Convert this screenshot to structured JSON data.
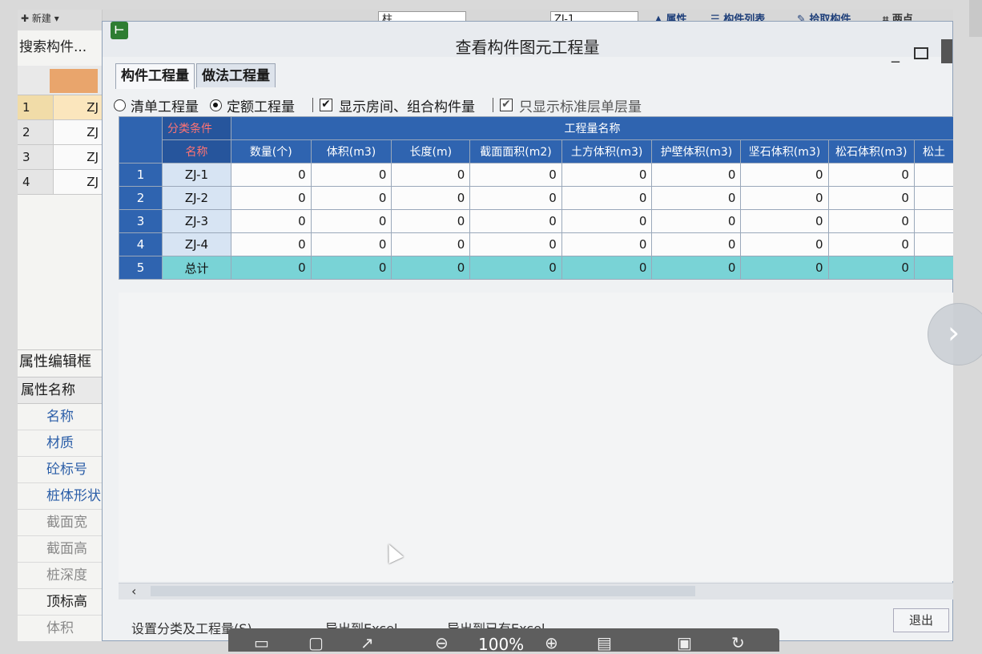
{
  "left_panel": {
    "toolbar_text": "新建",
    "search_text": "搜索构件...",
    "list": [
      {
        "idx": "1",
        "name": "ZJ"
      },
      {
        "idx": "2",
        "name": "ZJ"
      },
      {
        "idx": "3",
        "name": "ZJ"
      },
      {
        "idx": "4",
        "name": "ZJ"
      }
    ],
    "prop_title": "属性编辑框",
    "prop_header": "属性名称",
    "props": [
      "名称",
      "材质",
      "砼标号",
      "桩体形状",
      "截面宽",
      "截面高",
      "桩深度",
      "顶标高",
      "体积"
    ]
  },
  "top_toolbar": {
    "combo1": "柱",
    "combo2": "ZJ-1",
    "properties": "属性",
    "component_list": "构件列表",
    "pick": "拾取构件",
    "two_points": "两点"
  },
  "dialog": {
    "title": "查看构件图元工程量",
    "icon": "app-icon",
    "tabs": [
      "构件工程量",
      "做法工程量"
    ],
    "options": {
      "bill_quantity": "清单工程量",
      "quota_quantity": "定额工程量",
      "show_rooms": "显示房间、组合构件量",
      "standard_floor": "只显示标准层单层量"
    },
    "table": {
      "category_label": "分类条件",
      "quantity_name_label": "工程量名称",
      "name_label": "名称",
      "columns": [
        "数量(个)",
        "体积(m3)",
        "长度(m)",
        "截面面积(m2)",
        "土方体积(m3)",
        "护壁体积(m3)",
        "坚石体积(m3)",
        "松石体积(m3)",
        "松土"
      ],
      "rows": [
        {
          "idx": "1",
          "name": "ZJ-1",
          "values": [
            "0",
            "0",
            "0",
            "0",
            "0",
            "0",
            "0",
            "0"
          ]
        },
        {
          "idx": "2",
          "name": "ZJ-2",
          "values": [
            "0",
            "0",
            "0",
            "0",
            "0",
            "0",
            "0",
            "0"
          ]
        },
        {
          "idx": "3",
          "name": "ZJ-3",
          "values": [
            "0",
            "0",
            "0",
            "0",
            "0",
            "0",
            "0",
            "0"
          ]
        },
        {
          "idx": "4",
          "name": "ZJ-4",
          "values": [
            "0",
            "0",
            "0",
            "0",
            "0",
            "0",
            "0",
            "0"
          ]
        },
        {
          "idx": "5",
          "name": "总计",
          "values": [
            "0",
            "0",
            "0",
            "0",
            "0",
            "0",
            "0",
            "0"
          ]
        }
      ]
    },
    "footer": {
      "set_category": "设置分类及工程量(S)",
      "export_excel": "导出到Excel",
      "export_existing_excel": "导出到已有Excel",
      "exit": "退出"
    }
  },
  "viewer": {
    "zoom": "100%"
  }
}
